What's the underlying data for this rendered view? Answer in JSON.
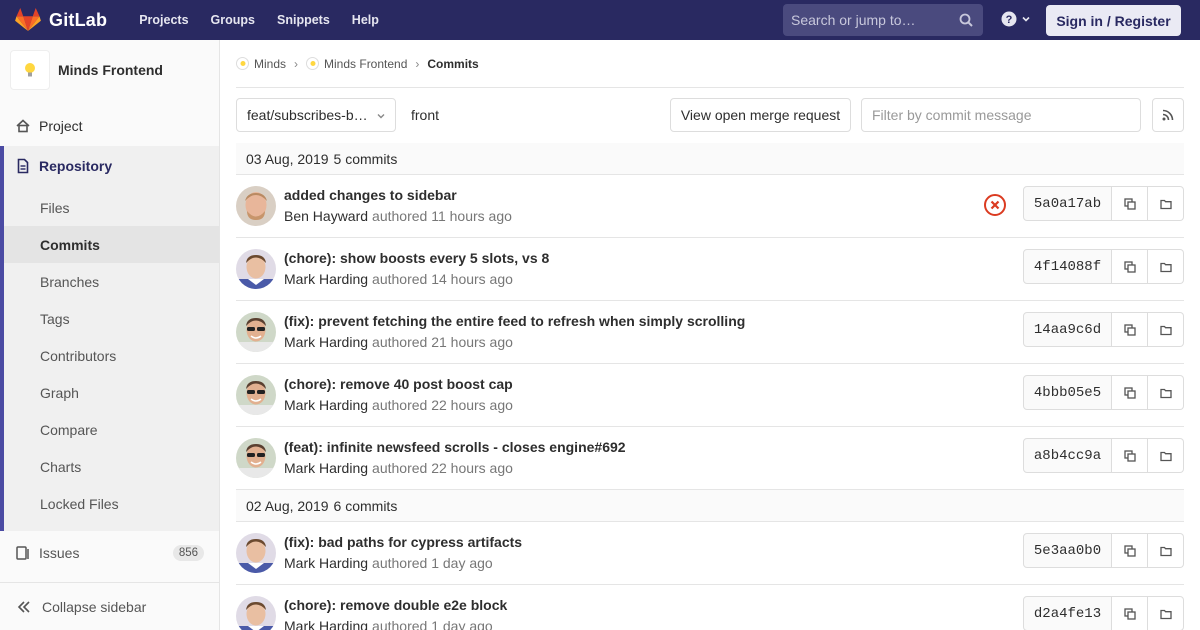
{
  "navbar": {
    "brand": "GitLab",
    "links": [
      "Projects",
      "Groups",
      "Snippets",
      "Help"
    ],
    "search_placeholder": "Search or jump to…",
    "signin": "Sign in / Register"
  },
  "sidebar": {
    "project_name": "Minds Frontend",
    "project": "Project",
    "repository": "Repository",
    "repo_items": [
      "Files",
      "Commits",
      "Branches",
      "Tags",
      "Contributors",
      "Graph",
      "Compare",
      "Charts",
      "Locked Files"
    ],
    "issues": "Issues",
    "issues_count": "856",
    "collapse": "Collapse sidebar"
  },
  "breadcrumbs": [
    "Minds",
    "Minds Frontend",
    "Commits"
  ],
  "toolbar": {
    "branch": "feat/subscribes-b…",
    "path": "front",
    "mr_button": "View open merge request",
    "filter_placeholder": "Filter by commit message"
  },
  "days": [
    {
      "date": "03 Aug, 2019",
      "count": "5 commits",
      "commits": [
        {
          "title": "added changes to sidebar",
          "author": "Ben Hayward",
          "authored": "authored 11 hours ago",
          "sha": "5a0a17ab",
          "status": "failed",
          "avatar": "ben"
        },
        {
          "title": "(chore): show boosts every 5 slots, vs 8",
          "author": "Mark Harding",
          "authored": "authored 14 hours ago",
          "sha": "4f14088f",
          "avatar": "mark1"
        },
        {
          "title": "(fix): prevent fetching the entire feed to refresh when simply scrolling",
          "author": "Mark Harding",
          "authored": "authored 21 hours ago",
          "sha": "14aa9c6d",
          "avatar": "mark2"
        },
        {
          "title": "(chore): remove 40 post boost cap",
          "author": "Mark Harding",
          "authored": "authored 22 hours ago",
          "sha": "4bbb05e5",
          "avatar": "mark2"
        },
        {
          "title": "(feat): infinite newsfeed scrolls - closes engine#692",
          "author": "Mark Harding",
          "authored": "authored 22 hours ago",
          "sha": "a8b4cc9a",
          "avatar": "mark2"
        }
      ]
    },
    {
      "date": "02 Aug, 2019",
      "count": "6 commits",
      "commits": [
        {
          "title": "(fix): bad paths for cypress artifacts",
          "author": "Mark Harding",
          "authored": "authored 1 day ago",
          "sha": "5e3aa0b0",
          "avatar": "mark1"
        },
        {
          "title": "(chore): remove double e2e block",
          "author": "Mark Harding",
          "authored": "authored 1 day ago",
          "sha": "d2a4fe13",
          "avatar": "mark1"
        }
      ]
    }
  ],
  "colors": {
    "navbar": "#292961",
    "accent": "#4b4ba3",
    "failed": "#db3b21"
  }
}
